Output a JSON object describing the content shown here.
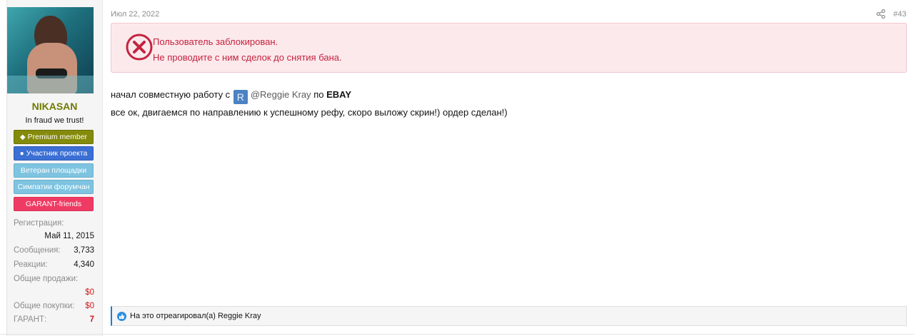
{
  "user": {
    "username": "NIKASAN",
    "user_title": "In fraud we trust!",
    "avatar": "avatar-photo",
    "banners": [
      {
        "label": "Premium member",
        "icon": "diamond-icon",
        "color": "#848a0a"
      },
      {
        "label": "Участник проекта",
        "icon": "user-icon",
        "color": "#3b6fd4"
      },
      {
        "label": "Ветеран площадки",
        "icon": "",
        "color": "#7ec3e0"
      },
      {
        "label": "Симпатии форумчан",
        "icon": "",
        "color": "#7ec3e0"
      },
      {
        "label": "GARANT-friends",
        "icon": "",
        "color": "#ef3b64"
      }
    ],
    "stats": {
      "registration_label": "Регистрация:",
      "registration_value": "Май 11, 2015",
      "messages_label": "Сообщения:",
      "messages_value": "3,733",
      "reactions_label": "Реакции:",
      "reactions_value": "4,340",
      "total_sales_label": "Общие продажи:",
      "total_sales_value": "$0",
      "total_purchases_label": "Общие покупки:",
      "total_purchases_value": "$0",
      "garant_label": "ГАРАНТ:",
      "garant_value": "7"
    }
  },
  "post": {
    "date": "Июл 22, 2022",
    "number": "#43",
    "share_icon": "share-icon",
    "ban_notice": {
      "icon": "ban-x-circle-icon",
      "line1": "Пользователь заблокирован.",
      "line2": "Не проводите с ним сделок до снятия бана."
    },
    "message": {
      "line1_prefix": "начал совместную работу с",
      "mention_avatar_letter": "R",
      "mention": "@Reggie Kray",
      "line1_mid": "по",
      "line1_bold": "EBAY",
      "line2": "все ок, двигаемся по направлению к успешному рефу, скоро выложу скрин!) ордер сделан!)"
    },
    "reactions": {
      "icon": "like-icon",
      "text": "На это отреагировал(а) Reggie Kray"
    }
  },
  "colors": {
    "username": "#6f7b00",
    "ban_text": "#c4233e",
    "ban_bg": "#fce9ec",
    "stat_red": "#d11a1a",
    "reaction_accent": "#1e7ecf"
  }
}
